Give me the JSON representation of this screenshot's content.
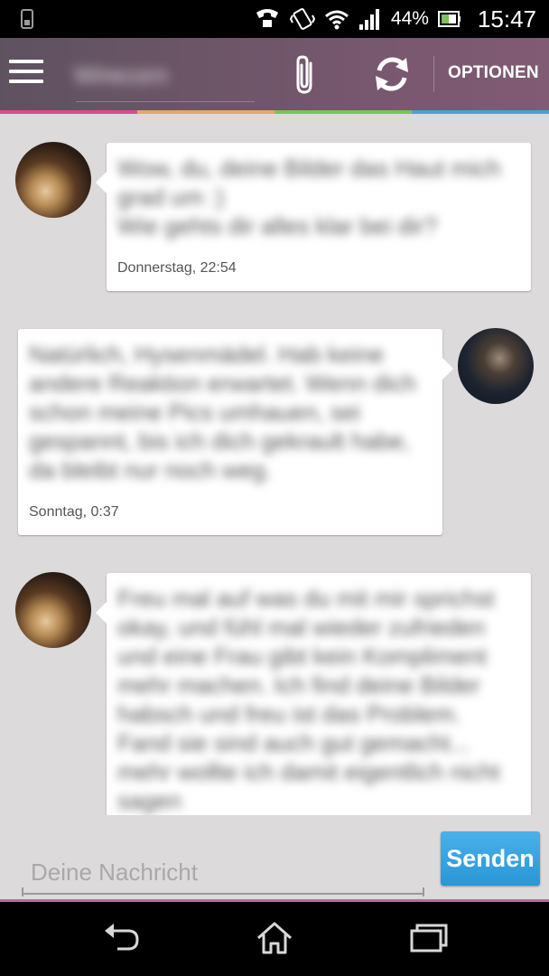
{
  "status_bar": {
    "battery_percent": "44%",
    "time": "15:47",
    "icons": [
      "sim-icon",
      "phone-call-icon",
      "vibrate-icon",
      "wifi-icon",
      "signal-icon",
      "battery-icon"
    ]
  },
  "action_bar": {
    "contact_name": "Wirecorn",
    "options_label": "OPTIONEN",
    "colors": {
      "stripe": [
        "#d84d8e",
        "#e8a66c",
        "#7ac35a",
        "#4ca0d8"
      ]
    }
  },
  "messages": [
    {
      "side": "left",
      "text": "Wow, du, deine Bilder das Haut mich grad um :)\nWie gehts dir alles klar bei dir?",
      "time": "Donnerstag, 22:54"
    },
    {
      "side": "right",
      "text": "Natürlich, Hysenmädel. Hab keine andere Reaktion erwartet. Wenn dich schon meine Pics umhauen, sei gespannt, bis ich dich gekrault habe, da bleibt nur noch weg.",
      "time": "Sonntag, 0:37"
    },
    {
      "side": "left",
      "text": "Freu mal auf was du mit mir sprichst okay, und fühl mal wieder zufrieden und eine Frau gibt kein Kompliment mehr machen. Ich find deine Bilder habsch und freu ist das Problem. Fand sie sind auch gut gemacht... mehr wollte ich damit eigentlich nicht sagen",
      "time": ""
    }
  ],
  "composer": {
    "placeholder": "Deine Nachricht",
    "value": "",
    "send_label": "Senden",
    "send_color": "#3aa4e2"
  }
}
